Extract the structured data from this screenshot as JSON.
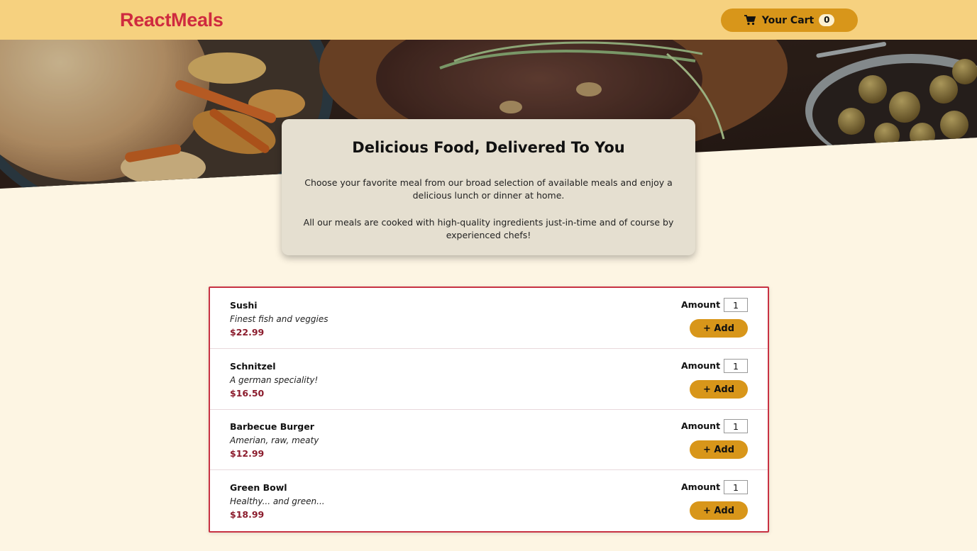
{
  "header": {
    "logo": "ReactMeals",
    "cart_button": {
      "label": "Your Cart",
      "count": "0"
    }
  },
  "summary": {
    "title": "Delicious Food, Delivered To You",
    "paragraph1": "Choose your favorite meal from our broad selection of available meals and enjoy a delicious lunch or dinner at home.",
    "paragraph2": "All our meals are cooked with high-quality ingredients just-in-time and of course by experienced chefs!"
  },
  "meals": [
    {
      "name": "Sushi",
      "description": "Finest fish and veggies",
      "price": "$22.99",
      "amount_label": "Amount",
      "amount": "1",
      "add_label": "+ Add"
    },
    {
      "name": "Schnitzel",
      "description": "A german speciality!",
      "price": "$16.50",
      "amount_label": "Amount",
      "amount": "1",
      "add_label": "+ Add"
    },
    {
      "name": "Barbecue Burger",
      "description": "Amerian, raw, meaty",
      "price": "$12.99",
      "amount_label": "Amount",
      "amount": "1",
      "add_label": "+ Add"
    },
    {
      "name": "Green Bowl",
      "description": "Healthy... and green...",
      "price": "$18.99",
      "amount_label": "Amount",
      "amount": "1",
      "add_label": "+ Add"
    }
  ],
  "colors": {
    "header_bg": "#f6d17f",
    "logo": "#cf2a3f",
    "button": "#d8961a",
    "price": "#8b1b2c",
    "page_bg": "#fdf5e3"
  }
}
